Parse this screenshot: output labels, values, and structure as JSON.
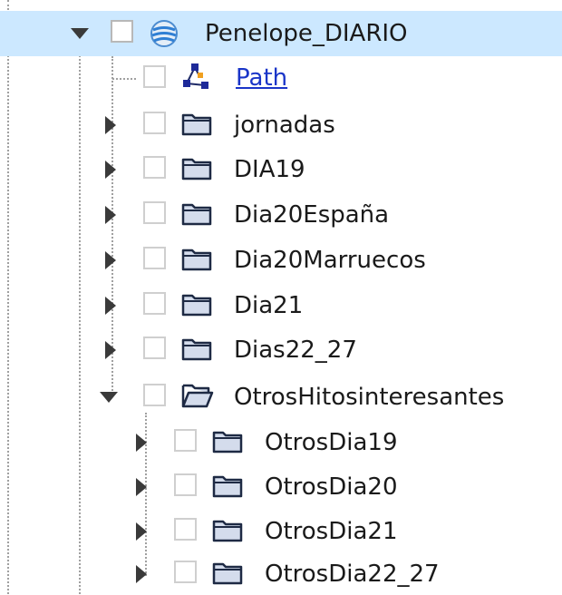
{
  "tree": {
    "root": {
      "label": "Penelope_DIARIO",
      "expanded": true,
      "icon": "globe-icon"
    },
    "path_node": {
      "label": "Path",
      "icon": "path-nodes-icon"
    },
    "folders": [
      {
        "label": "jornadas"
      },
      {
        "label": "DIA19"
      },
      {
        "label": "Dia20España"
      },
      {
        "label": "Dia20Marruecos"
      },
      {
        "label": "Dia21"
      },
      {
        "label": "Dias22_27"
      }
    ],
    "open_folder": {
      "label": "OtrosHitosinteresantes",
      "expanded": true,
      "icon": "folder-open-icon"
    },
    "subfolders": [
      {
        "label": "OtrosDia19"
      },
      {
        "label": "OtrosDia20"
      },
      {
        "label": "OtrosDia21"
      },
      {
        "label": "OtrosDia22_27"
      }
    ]
  },
  "colors": {
    "selection": "#cce8ff",
    "link": "#1a35c8",
    "folder_fill": "#d4dcec",
    "folder_stroke": "#1e2a44"
  }
}
